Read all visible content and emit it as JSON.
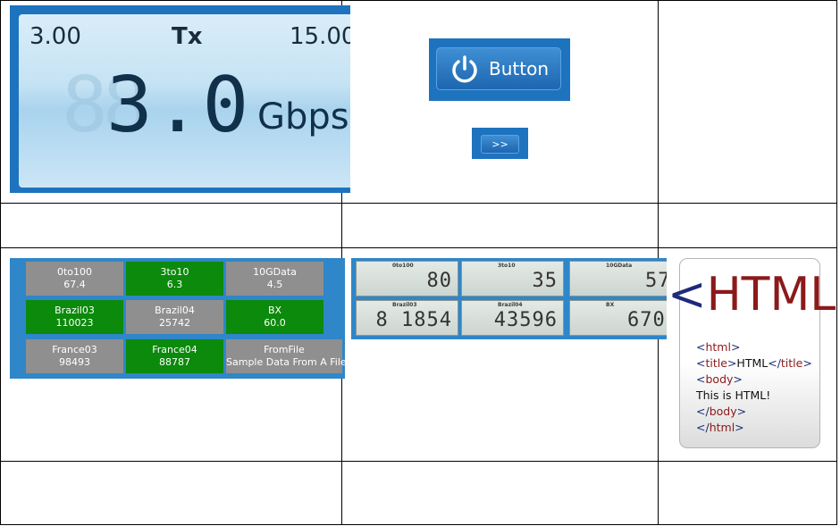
{
  "gauge": {
    "title": "Tx",
    "min": "3.00",
    "max": "15.00",
    "ghost_digits": "88",
    "value": "3.0",
    "unit": "Gbps"
  },
  "buttons": {
    "power_label": "Button",
    "next_label": ">>"
  },
  "tiles": [
    {
      "name": "0to100",
      "value": "67.4",
      "color": "#8f8f8f"
    },
    {
      "name": "3to10",
      "value": "6.3",
      "color": "#0b8a0b"
    },
    {
      "name": "10GData",
      "value": "4.5",
      "color": "#8f8f8f"
    },
    {
      "name": "Brazil03",
      "value": "110023",
      "color": "#0b8a0b"
    },
    {
      "name": "Brazil04",
      "value": "25742",
      "color": "#8f8f8f"
    },
    {
      "name": "BX",
      "value": "60.0",
      "color": "#0b8a0b"
    },
    {
      "name": "France03",
      "value": "98493",
      "color": "#8f8f8f"
    },
    {
      "name": "France04",
      "value": "88787",
      "color": "#0b8a0b"
    },
    {
      "name": "FromFile",
      "value": "Sample Data From A File",
      "color": "#8f8f8f"
    }
  ],
  "lcd": [
    {
      "name": "0to100",
      "value": "80"
    },
    {
      "name": "3to10",
      "value": "35"
    },
    {
      "name": "10GData",
      "value": "57"
    },
    {
      "name": "Brazil03",
      "value": "8 1854"
    },
    {
      "name": "Brazil04",
      "value": "43596"
    },
    {
      "name": "BX",
      "value": "670"
    }
  ],
  "html_card": {
    "big_open": "<",
    "big_word": "HTML",
    "big_close": ">",
    "lines": [
      {
        "open": "<",
        "tag1": "html",
        "close": ">",
        "text": ""
      },
      {
        "open": "<",
        "tag1": "title",
        "close": ">",
        "text": "HTML",
        "end_open": "</",
        "tag2": "title",
        "end_close": ">"
      },
      {
        "open": "<",
        "tag1": "body",
        "close": ">",
        "text": ""
      },
      {
        "text_only": "This is HTML!"
      },
      {
        "open": "</",
        "tag1": "body",
        "close": ">",
        "text": ""
      },
      {
        "open": "</",
        "tag1": "html",
        "close": ">",
        "text": ""
      }
    ]
  }
}
